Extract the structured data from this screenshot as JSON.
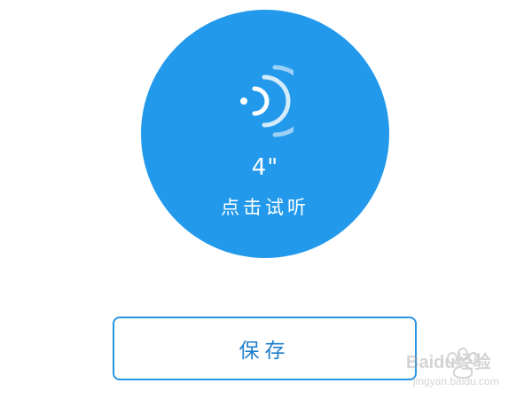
{
  "recording": {
    "icon": "sound-wave-icon",
    "duration": "4\"",
    "hint": "点击试听"
  },
  "actions": {
    "save_label": "保存"
  },
  "watermark": {
    "text": "Baidu经验",
    "url": "jingyan.baidu.com"
  },
  "colors": {
    "accent": "#2399ec",
    "button_border": "#2a95e1",
    "button_text": "#1f7fcc",
    "background": "#ffffff"
  }
}
